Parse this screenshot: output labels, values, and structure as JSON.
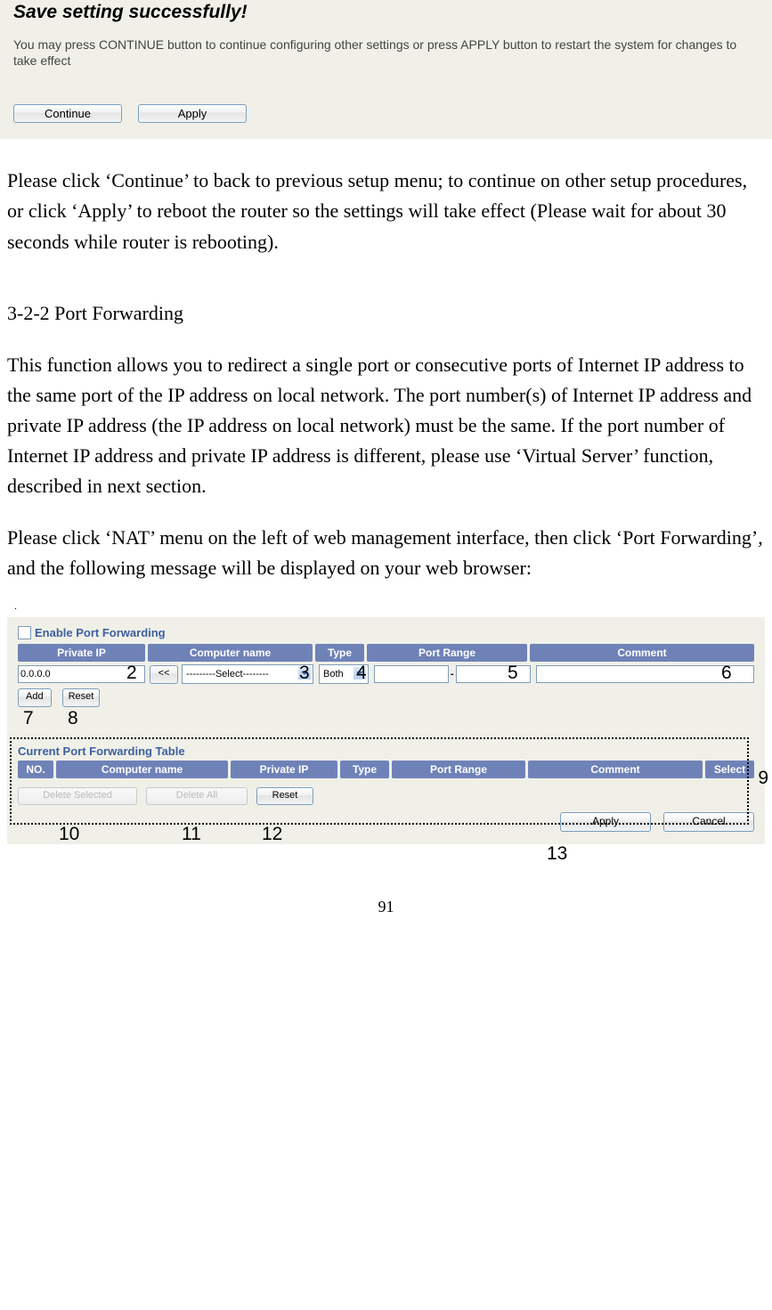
{
  "save_panel": {
    "heading": "Save setting successfully!",
    "desc": "You may press CONTINUE button to continue configuring other settings or press APPLY button to restart the system for changes to take effect",
    "continue_btn": "Continue",
    "apply_btn": "Apply"
  },
  "body": {
    "para1": "Please click ‘Continue’ to back to previous setup menu; to continue on other setup procedures, or click ‘Apply’ to reboot the router so the settings will take effect (Please wait for about 30 seconds while router is rebooting).",
    "heading2": "3-2-2 Port Forwarding",
    "para2": "This function allows you to redirect a single port or consecutive ports of Internet IP address to the same port of the IP address on local network. The port number(s) of Internet IP address and private IP address (the IP address on local network) must be the same. If the port number of Internet IP address and private IP address is different, please use ‘Virtual Server’ function, described in next section.",
    "para3": "Please click ‘NAT’ menu on the left of web management interface, then click ‘Port Forwarding’, and the following message will be displayed on your web browser:"
  },
  "pf_panel": {
    "enable_label": "Enable Port Forwarding",
    "headers": {
      "private_ip": "Private IP",
      "computer_name": "Computer name",
      "type": "Type",
      "port_range": "Port Range",
      "comment": "Comment"
    },
    "row": {
      "private_ip_value": "0.0.0.0",
      "copy_btn": "<<",
      "select_text": "---------Select--------",
      "type_value": "Both",
      "port_start": "",
      "port_dash": "-",
      "port_end": "",
      "comment_value": ""
    },
    "add_btn": "Add",
    "reset_btn": "Reset",
    "current_title": "Current Port Forwarding Table",
    "current_headers": {
      "no": "NO.",
      "computer_name": "Computer name",
      "private_ip": "Private IP",
      "type": "Type",
      "port_range": "Port Range",
      "comment": "Comment",
      "select": "Select"
    },
    "delete_selected_btn": "Delete Selected",
    "delete_all_btn": "Delete All",
    "reset2_btn": "Reset",
    "apply_btn": "Apply",
    "cancel_btn": "Cancel"
  },
  "annotations": {
    "a2": "2",
    "a3": "3",
    "a4": "4",
    "a5": "5",
    "a6": "6",
    "a7": "7",
    "a8": "8",
    "a9": "9",
    "a10": "10",
    "a11": "11",
    "a12": "12",
    "a13": "13"
  },
  "page_number": "91"
}
